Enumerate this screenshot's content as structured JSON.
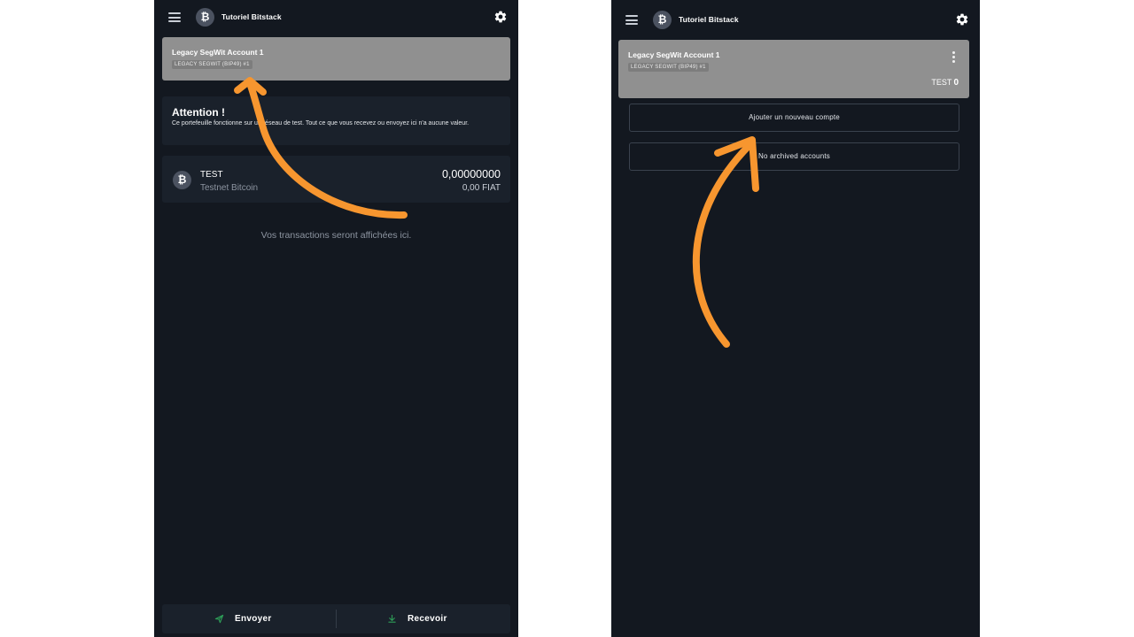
{
  "colors": {
    "background": "#131820",
    "card": "#1a212b",
    "account_card": "#909090",
    "annotation_arrow": "#f7962f",
    "send_icon": "#2e9e58"
  },
  "left_screen": {
    "header": {
      "wallet_name": "Tutoriel Bitstack",
      "menu_icon": "hamburger-icon",
      "logo_icon": "bitcoin-icon",
      "settings_icon": "gear-icon"
    },
    "account": {
      "name": "Legacy SegWit Account 1",
      "tag": "LEGACY SEGWIT (BIP49) #1"
    },
    "attention": {
      "title": "Attention !",
      "text": "Ce portefeuille fonctionne sur un réseau de test. Tout ce que vous recevez ou envoyez ici n'a aucune valeur."
    },
    "asset": {
      "icon": "bitcoin-icon",
      "symbol": "TEST",
      "network": "Testnet Bitcoin",
      "amount": "0,00000000",
      "fiat": "0,00 FIAT"
    },
    "empty_state": "Vos transactions seront affichées ici.",
    "actions": {
      "send_label": "Envoyer",
      "send_icon": "send-icon",
      "receive_label": "Recevoir",
      "receive_icon": "download-icon"
    }
  },
  "right_screen": {
    "header": {
      "wallet_name": "Tutoriel Bitstack",
      "menu_icon": "hamburger-icon",
      "logo_icon": "bitcoin-icon",
      "settings_icon": "gear-icon"
    },
    "account": {
      "name": "Legacy SegWit Account 1",
      "tag": "LEGACY SEGWIT (BIP49) #1",
      "balance_unit": "TEST",
      "balance_value": "0",
      "menu_icon": "kebab-icon"
    },
    "add_account_label": "Ajouter un nouveau compte",
    "archived_accounts_label": "No archived accounts"
  }
}
